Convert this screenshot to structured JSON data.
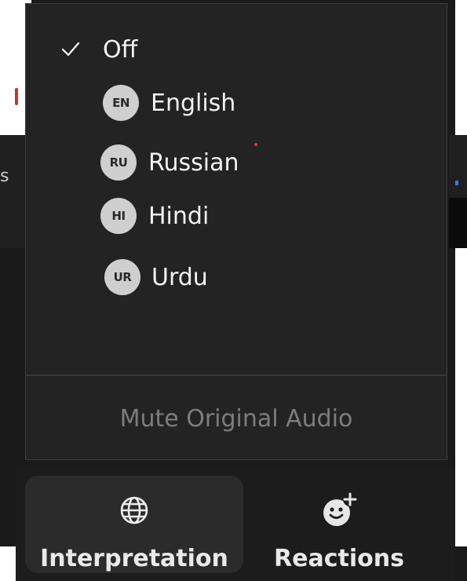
{
  "menu": {
    "off": {
      "label": "Off",
      "checked": true
    },
    "languages": [
      {
        "code": "EN",
        "label": "English"
      },
      {
        "code": "RU",
        "label": "Russian"
      },
      {
        "code": "HI",
        "label": "Hindi"
      },
      {
        "code": "UR",
        "label": "Urdu"
      }
    ],
    "mute_original": {
      "label": "Mute Original Audio",
      "enabled": false
    }
  },
  "toolbar": {
    "interpretation": {
      "label": "Interpretation",
      "icon": "globe-icon"
    },
    "reactions": {
      "label": "Reactions",
      "icon": "emoji-add-icon"
    }
  },
  "background": {
    "left_letter": "s"
  },
  "colors": {
    "menu_bg": "#232323",
    "text": "#f3f3f3",
    "badge_bg": "#cfcfcf",
    "disabled_text": "#7d7d7d",
    "toolbar_bg": "#1c1c1c"
  }
}
